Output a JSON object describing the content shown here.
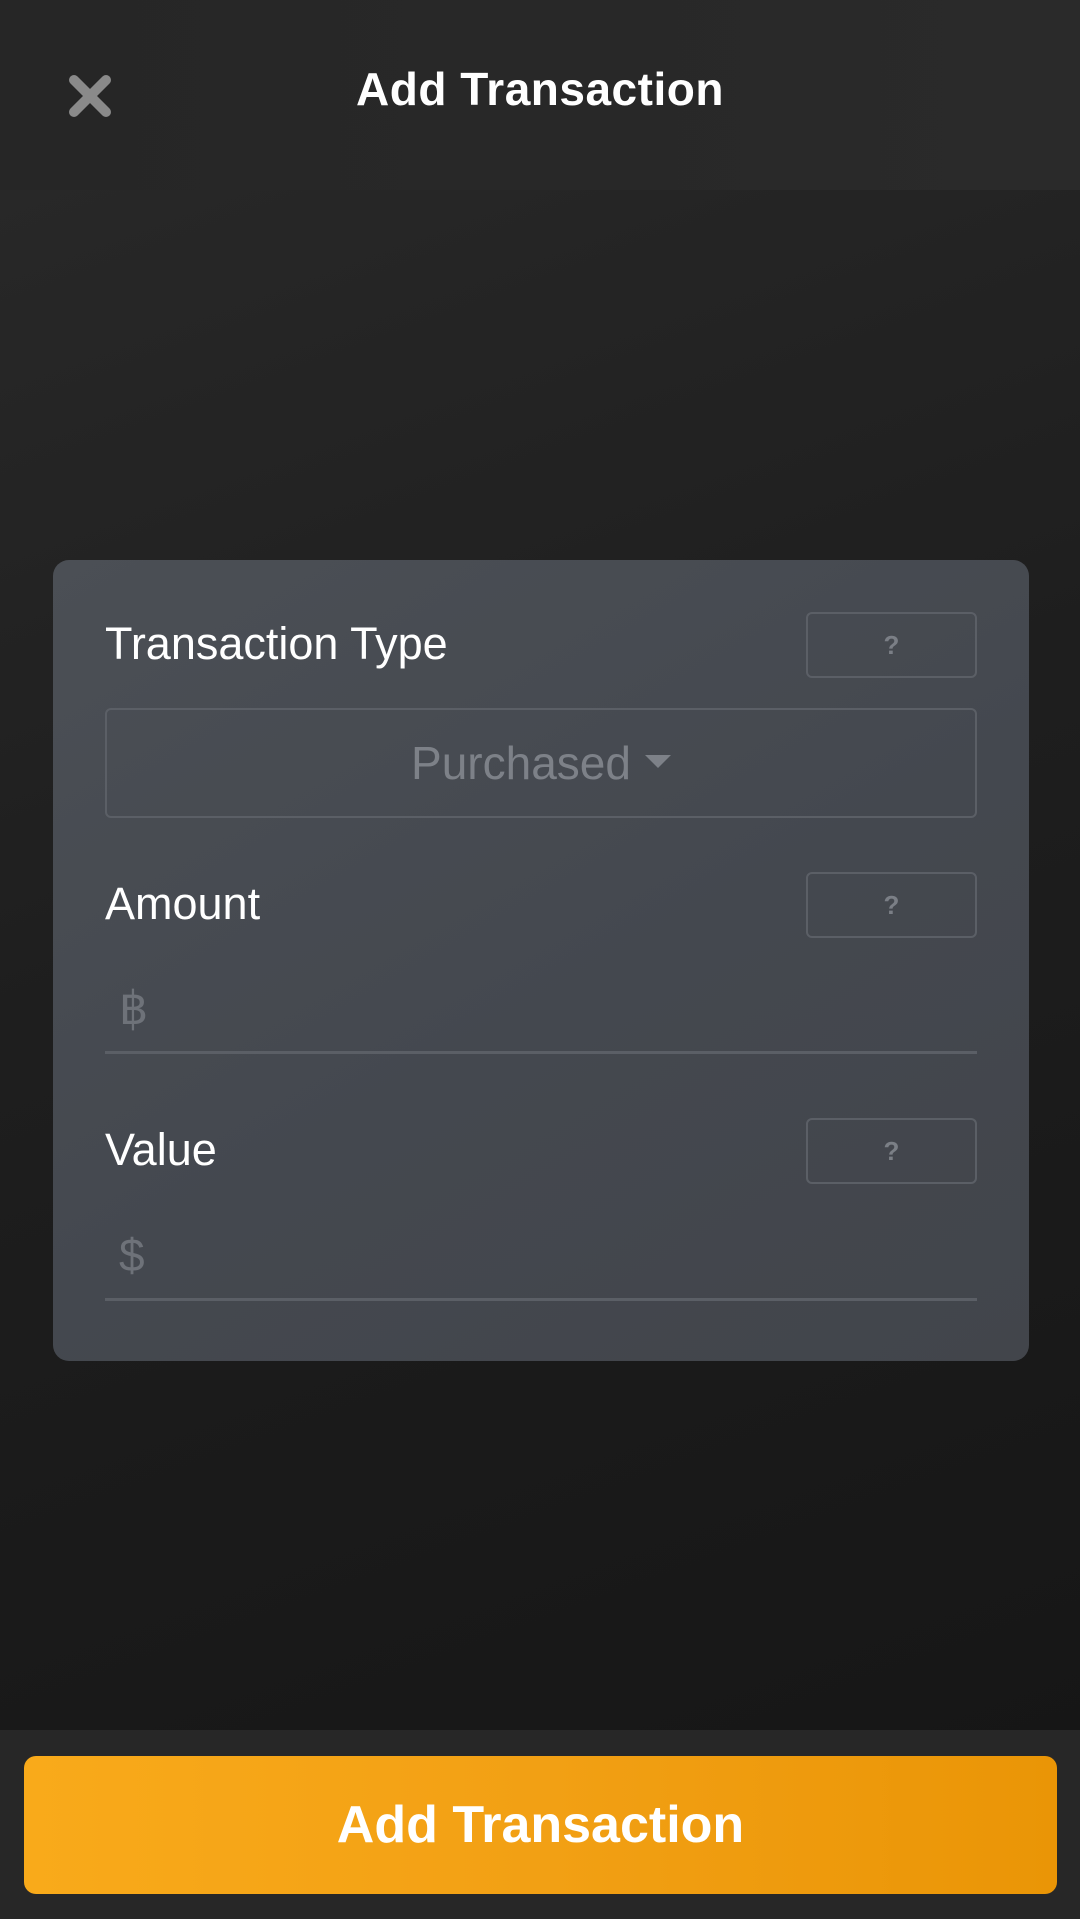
{
  "header": {
    "title": "Add Transaction",
    "close_icon": "close-icon"
  },
  "form": {
    "transaction_type": {
      "label": "Transaction Type",
      "help_label": "?",
      "selected_value": "Purchased"
    },
    "amount": {
      "label": "Amount",
      "help_label": "?",
      "currency_symbol": "฿",
      "value": ""
    },
    "value": {
      "label": "Value",
      "help_label": "?",
      "currency_symbol": "$",
      "value": ""
    }
  },
  "footer": {
    "submit_label": "Add Transaction"
  },
  "colors": {
    "accent": "#f5a312",
    "card_background": "#474b51",
    "background": "#1e1e1e"
  }
}
